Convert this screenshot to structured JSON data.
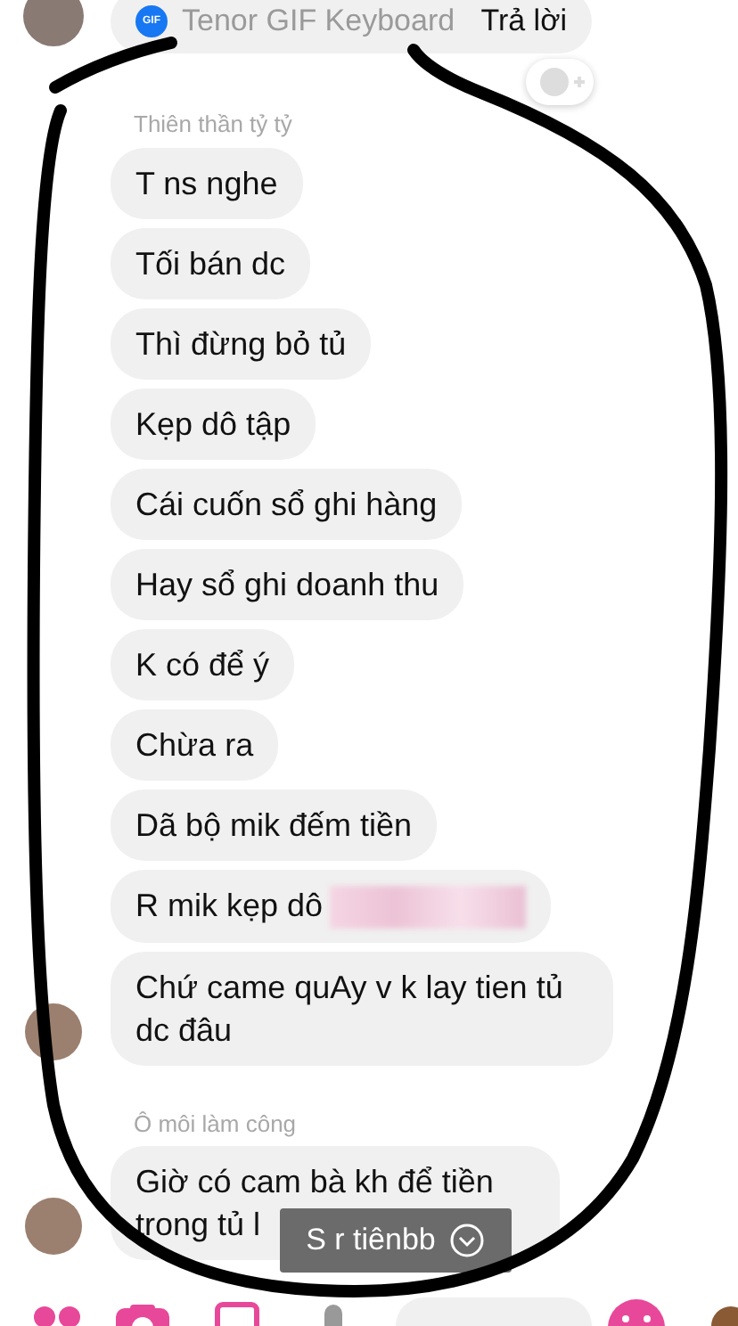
{
  "top_message": {
    "gif_badge": "GIF",
    "app_label": "Tenor GIF Keyboard",
    "reply_button": "Trả lời"
  },
  "groups": [
    {
      "sender": "Thiên thần tỷ tỷ",
      "messages": [
        {
          "text": "T ns nghe",
          "redacted": false
        },
        {
          "text": "Tối bán dc",
          "redacted": false
        },
        {
          "text": "Thì đừng bỏ tủ",
          "redacted": false
        },
        {
          "text": "Kẹp dô tập",
          "redacted": false
        },
        {
          "text": "Cái cuốn sổ ghi hàng",
          "redacted": false
        },
        {
          "text": "Hay sổ ghi doanh thu",
          "redacted": false
        },
        {
          "text": "K có để ý",
          "redacted": false
        },
        {
          "text": "Chừa ra",
          "redacted": false
        },
        {
          "text": "Dã bộ mik đếm tiền",
          "redacted": false
        },
        {
          "text": "R mik kẹp dô",
          "redacted": true
        },
        {
          "text": "Chứ came quAy v k lay tien tủ dc đâu",
          "redacted": false
        }
      ]
    },
    {
      "sender": "Ô môi làm công",
      "messages": [
        {
          "text": "Giờ có cam bà kh để tiền trong tủ l",
          "redacted": false
        }
      ]
    }
  ],
  "toast": {
    "text": "S r tiênbb"
  }
}
